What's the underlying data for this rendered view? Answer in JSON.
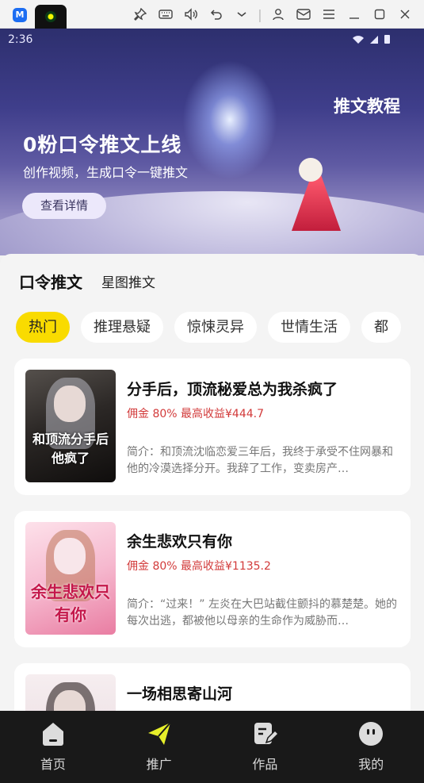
{
  "topbar": {
    "icons": [
      "app-logo-icon",
      "game-icon",
      "pin-icon",
      "keyboard-icon",
      "volume-icon",
      "undo-icon",
      "chevron-down-icon",
      "account-icon",
      "mail-icon",
      "menu-icon",
      "minimize-icon",
      "maximize-icon",
      "close-icon"
    ],
    "separator": "|"
  },
  "status_bar": {
    "time": "2:36"
  },
  "banner": {
    "tag": "推文教程",
    "title": "0粉口令推文上线",
    "subtitle": "创作视频，生成口令一键推文",
    "button": "查看详情"
  },
  "tabs": [
    {
      "label": "口令推文",
      "active": true
    },
    {
      "label": "星图推文",
      "active": false
    }
  ],
  "chips": [
    {
      "label": "热门",
      "active": true
    },
    {
      "label": "推理悬疑",
      "active": false
    },
    {
      "label": "惊悚灵异",
      "active": false
    },
    {
      "label": "世情生活",
      "active": false
    },
    {
      "label": "都",
      "active": false
    }
  ],
  "books": [
    {
      "title": "分手后，顶流秘爱总为我杀疯了",
      "earn": "佣金 80%  最高收益¥444.7",
      "desc": "简介：和顶流沈临恋爱三年后，我终于承受不住网暴和他的冷漠选择分开。我辞了工作，变卖房产…",
      "cover_text": "和顶流分手后他疯了"
    },
    {
      "title": "余生悲欢只有你",
      "earn": "佣金 80%  最高收益¥1135.2",
      "desc": "简介：“过来！” 左炎在大巴站截住颤抖的慕楚楚。她的每次出逃，都被他以母亲的生命作为威胁而…",
      "cover_text": "余生悲欢只有你"
    },
    {
      "title": "一场相思寄山河",
      "earn": "",
      "desc": "",
      "cover_text": ""
    }
  ],
  "nav": [
    {
      "label": "首页",
      "icon": "home-icon",
      "active": false
    },
    {
      "label": "推广",
      "icon": "send-icon",
      "active": true
    },
    {
      "label": "作品",
      "icon": "edit-icon",
      "active": false
    },
    {
      "label": "我的",
      "icon": "profile-icon",
      "active": false
    }
  ],
  "colors": {
    "accent": "#f9db00",
    "earn": "#d23a3a",
    "nav_bg": "#191919",
    "nav_active": "#e6ef2a"
  }
}
